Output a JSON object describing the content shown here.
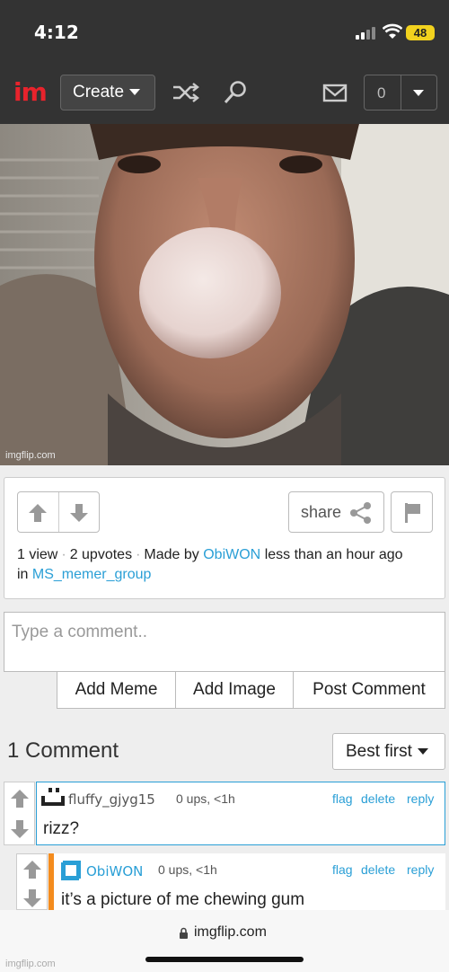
{
  "status": {
    "time": "4:12",
    "battery": "48"
  },
  "nav": {
    "logo": "im",
    "create_label": "Create",
    "notifications_count": "0"
  },
  "meme": {
    "watermark": "imgflip.com"
  },
  "post": {
    "share_label": "share",
    "views": "1 view",
    "upvotes": "2 upvotes",
    "made_by_prefix": "Made by",
    "author": "ObiWON",
    "time": "less than an hour ago",
    "in_prefix": "in",
    "group": "MS_memer_group"
  },
  "comment_form": {
    "placeholder": "Type a comment..",
    "add_meme": "Add Meme",
    "add_image": "Add Image",
    "post_comment": "Post Comment"
  },
  "comments_header": {
    "title": "1 Comment",
    "sort": "Best first"
  },
  "comments": [
    {
      "user": "fluffy_gjyg15",
      "meta": "0 ups, <1h",
      "flag": "flag",
      "delete": "delete",
      "reply": "reply",
      "text": "rizz?"
    },
    {
      "user": "ObiWON",
      "meta": "0 ups, <1h",
      "flag": "flag",
      "delete": "delete",
      "reply": "reply",
      "text": "it’s a picture of me chewing gum"
    }
  ],
  "browser": {
    "url": "imgflip.com",
    "watermark": "imgflip.com"
  },
  "colors": {
    "bar": "#333333",
    "link": "#2a9fd6",
    "logo_red": "#e8232c",
    "accent_orange": "#f48c1e",
    "battery": "#f2d21e"
  }
}
